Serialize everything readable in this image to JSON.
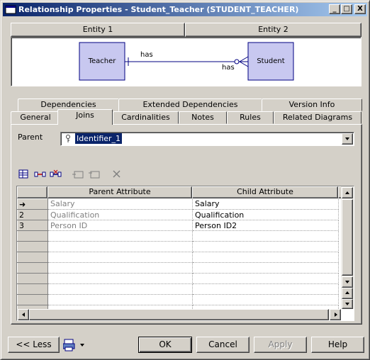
{
  "window": {
    "title": "Relationship Properties - Student_Teacher (STUDENT_TEACHER)"
  },
  "title_buttons": {
    "minimize": "_",
    "maximize": "□",
    "close": "X"
  },
  "diagram": {
    "entity1_header": "Entity 1",
    "entity2_header": "Entity 2",
    "entity1_name": "Teacher",
    "entity2_name": "Student",
    "role1": "has",
    "role2": "has",
    "entity_fill": "#c8c8f0",
    "line_color": "#000080"
  },
  "tabs": {
    "row_back": [
      "Dependencies",
      "Extended Dependencies",
      "Version Info"
    ],
    "row_front": [
      "General",
      "Joins",
      "Cardinalities",
      "Notes",
      "Rules",
      "Related Diagrams"
    ],
    "active": "Joins"
  },
  "parent": {
    "label": "Parent",
    "value": "Identifier_1"
  },
  "toolbar_icons": [
    "reuse-columns-icon",
    "migrate-columns-icon",
    "cancel-migration-icon",
    "insert-row-icon",
    "add-row-icon",
    "delete-icon"
  ],
  "grid": {
    "columns": [
      "Parent Attribute",
      "Child Attribute"
    ],
    "rows": [
      {
        "marker": "➜",
        "parent": "Salary",
        "child": "Salary"
      },
      {
        "marker": "2",
        "parent": "Qualification",
        "child": "Qualification"
      },
      {
        "marker": "3",
        "parent": "Person ID",
        "child": "Person ID2"
      }
    ],
    "empty_row_count": 10
  },
  "buttons": {
    "less": "<< Less",
    "ok": "OK",
    "cancel": "Cancel",
    "apply": "Apply",
    "help": "Help"
  }
}
